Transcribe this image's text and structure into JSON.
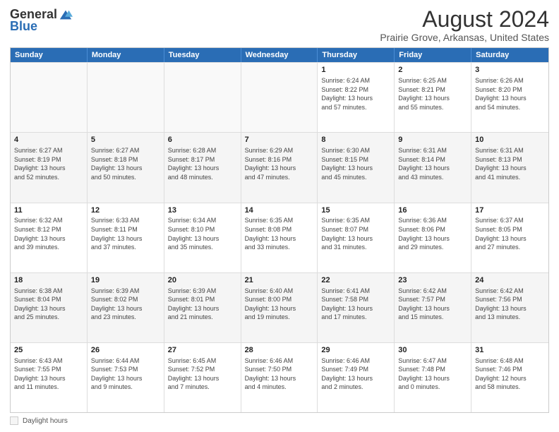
{
  "logo": {
    "general": "General",
    "blue": "Blue"
  },
  "title": "August 2024",
  "subtitle": "Prairie Grove, Arkansas, United States",
  "header_days": [
    "Sunday",
    "Monday",
    "Tuesday",
    "Wednesday",
    "Thursday",
    "Friday",
    "Saturday"
  ],
  "legend_label": "Daylight hours",
  "rows": [
    [
      {
        "day": "",
        "info": "",
        "empty": true
      },
      {
        "day": "",
        "info": "",
        "empty": true
      },
      {
        "day": "",
        "info": "",
        "empty": true
      },
      {
        "day": "",
        "info": "",
        "empty": true
      },
      {
        "day": "1",
        "info": "Sunrise: 6:24 AM\nSunset: 8:22 PM\nDaylight: 13 hours\nand 57 minutes.",
        "empty": false
      },
      {
        "day": "2",
        "info": "Sunrise: 6:25 AM\nSunset: 8:21 PM\nDaylight: 13 hours\nand 55 minutes.",
        "empty": false
      },
      {
        "day": "3",
        "info": "Sunrise: 6:26 AM\nSunset: 8:20 PM\nDaylight: 13 hours\nand 54 minutes.",
        "empty": false
      }
    ],
    [
      {
        "day": "4",
        "info": "Sunrise: 6:27 AM\nSunset: 8:19 PM\nDaylight: 13 hours\nand 52 minutes.",
        "empty": false
      },
      {
        "day": "5",
        "info": "Sunrise: 6:27 AM\nSunset: 8:18 PM\nDaylight: 13 hours\nand 50 minutes.",
        "empty": false
      },
      {
        "day": "6",
        "info": "Sunrise: 6:28 AM\nSunset: 8:17 PM\nDaylight: 13 hours\nand 48 minutes.",
        "empty": false
      },
      {
        "day": "7",
        "info": "Sunrise: 6:29 AM\nSunset: 8:16 PM\nDaylight: 13 hours\nand 47 minutes.",
        "empty": false
      },
      {
        "day": "8",
        "info": "Sunrise: 6:30 AM\nSunset: 8:15 PM\nDaylight: 13 hours\nand 45 minutes.",
        "empty": false
      },
      {
        "day": "9",
        "info": "Sunrise: 6:31 AM\nSunset: 8:14 PM\nDaylight: 13 hours\nand 43 minutes.",
        "empty": false
      },
      {
        "day": "10",
        "info": "Sunrise: 6:31 AM\nSunset: 8:13 PM\nDaylight: 13 hours\nand 41 minutes.",
        "empty": false
      }
    ],
    [
      {
        "day": "11",
        "info": "Sunrise: 6:32 AM\nSunset: 8:12 PM\nDaylight: 13 hours\nand 39 minutes.",
        "empty": false
      },
      {
        "day": "12",
        "info": "Sunrise: 6:33 AM\nSunset: 8:11 PM\nDaylight: 13 hours\nand 37 minutes.",
        "empty": false
      },
      {
        "day": "13",
        "info": "Sunrise: 6:34 AM\nSunset: 8:10 PM\nDaylight: 13 hours\nand 35 minutes.",
        "empty": false
      },
      {
        "day": "14",
        "info": "Sunrise: 6:35 AM\nSunset: 8:08 PM\nDaylight: 13 hours\nand 33 minutes.",
        "empty": false
      },
      {
        "day": "15",
        "info": "Sunrise: 6:35 AM\nSunset: 8:07 PM\nDaylight: 13 hours\nand 31 minutes.",
        "empty": false
      },
      {
        "day": "16",
        "info": "Sunrise: 6:36 AM\nSunset: 8:06 PM\nDaylight: 13 hours\nand 29 minutes.",
        "empty": false
      },
      {
        "day": "17",
        "info": "Sunrise: 6:37 AM\nSunset: 8:05 PM\nDaylight: 13 hours\nand 27 minutes.",
        "empty": false
      }
    ],
    [
      {
        "day": "18",
        "info": "Sunrise: 6:38 AM\nSunset: 8:04 PM\nDaylight: 13 hours\nand 25 minutes.",
        "empty": false
      },
      {
        "day": "19",
        "info": "Sunrise: 6:39 AM\nSunset: 8:02 PM\nDaylight: 13 hours\nand 23 minutes.",
        "empty": false
      },
      {
        "day": "20",
        "info": "Sunrise: 6:39 AM\nSunset: 8:01 PM\nDaylight: 13 hours\nand 21 minutes.",
        "empty": false
      },
      {
        "day": "21",
        "info": "Sunrise: 6:40 AM\nSunset: 8:00 PM\nDaylight: 13 hours\nand 19 minutes.",
        "empty": false
      },
      {
        "day": "22",
        "info": "Sunrise: 6:41 AM\nSunset: 7:58 PM\nDaylight: 13 hours\nand 17 minutes.",
        "empty": false
      },
      {
        "day": "23",
        "info": "Sunrise: 6:42 AM\nSunset: 7:57 PM\nDaylight: 13 hours\nand 15 minutes.",
        "empty": false
      },
      {
        "day": "24",
        "info": "Sunrise: 6:42 AM\nSunset: 7:56 PM\nDaylight: 13 hours\nand 13 minutes.",
        "empty": false
      }
    ],
    [
      {
        "day": "25",
        "info": "Sunrise: 6:43 AM\nSunset: 7:55 PM\nDaylight: 13 hours\nand 11 minutes.",
        "empty": false
      },
      {
        "day": "26",
        "info": "Sunrise: 6:44 AM\nSunset: 7:53 PM\nDaylight: 13 hours\nand 9 minutes.",
        "empty": false
      },
      {
        "day": "27",
        "info": "Sunrise: 6:45 AM\nSunset: 7:52 PM\nDaylight: 13 hours\nand 7 minutes.",
        "empty": false
      },
      {
        "day": "28",
        "info": "Sunrise: 6:46 AM\nSunset: 7:50 PM\nDaylight: 13 hours\nand 4 minutes.",
        "empty": false
      },
      {
        "day": "29",
        "info": "Sunrise: 6:46 AM\nSunset: 7:49 PM\nDaylight: 13 hours\nand 2 minutes.",
        "empty": false
      },
      {
        "day": "30",
        "info": "Sunrise: 6:47 AM\nSunset: 7:48 PM\nDaylight: 13 hours\nand 0 minutes.",
        "empty": false
      },
      {
        "day": "31",
        "info": "Sunrise: 6:48 AM\nSunset: 7:46 PM\nDaylight: 12 hours\nand 58 minutes.",
        "empty": false
      }
    ]
  ]
}
